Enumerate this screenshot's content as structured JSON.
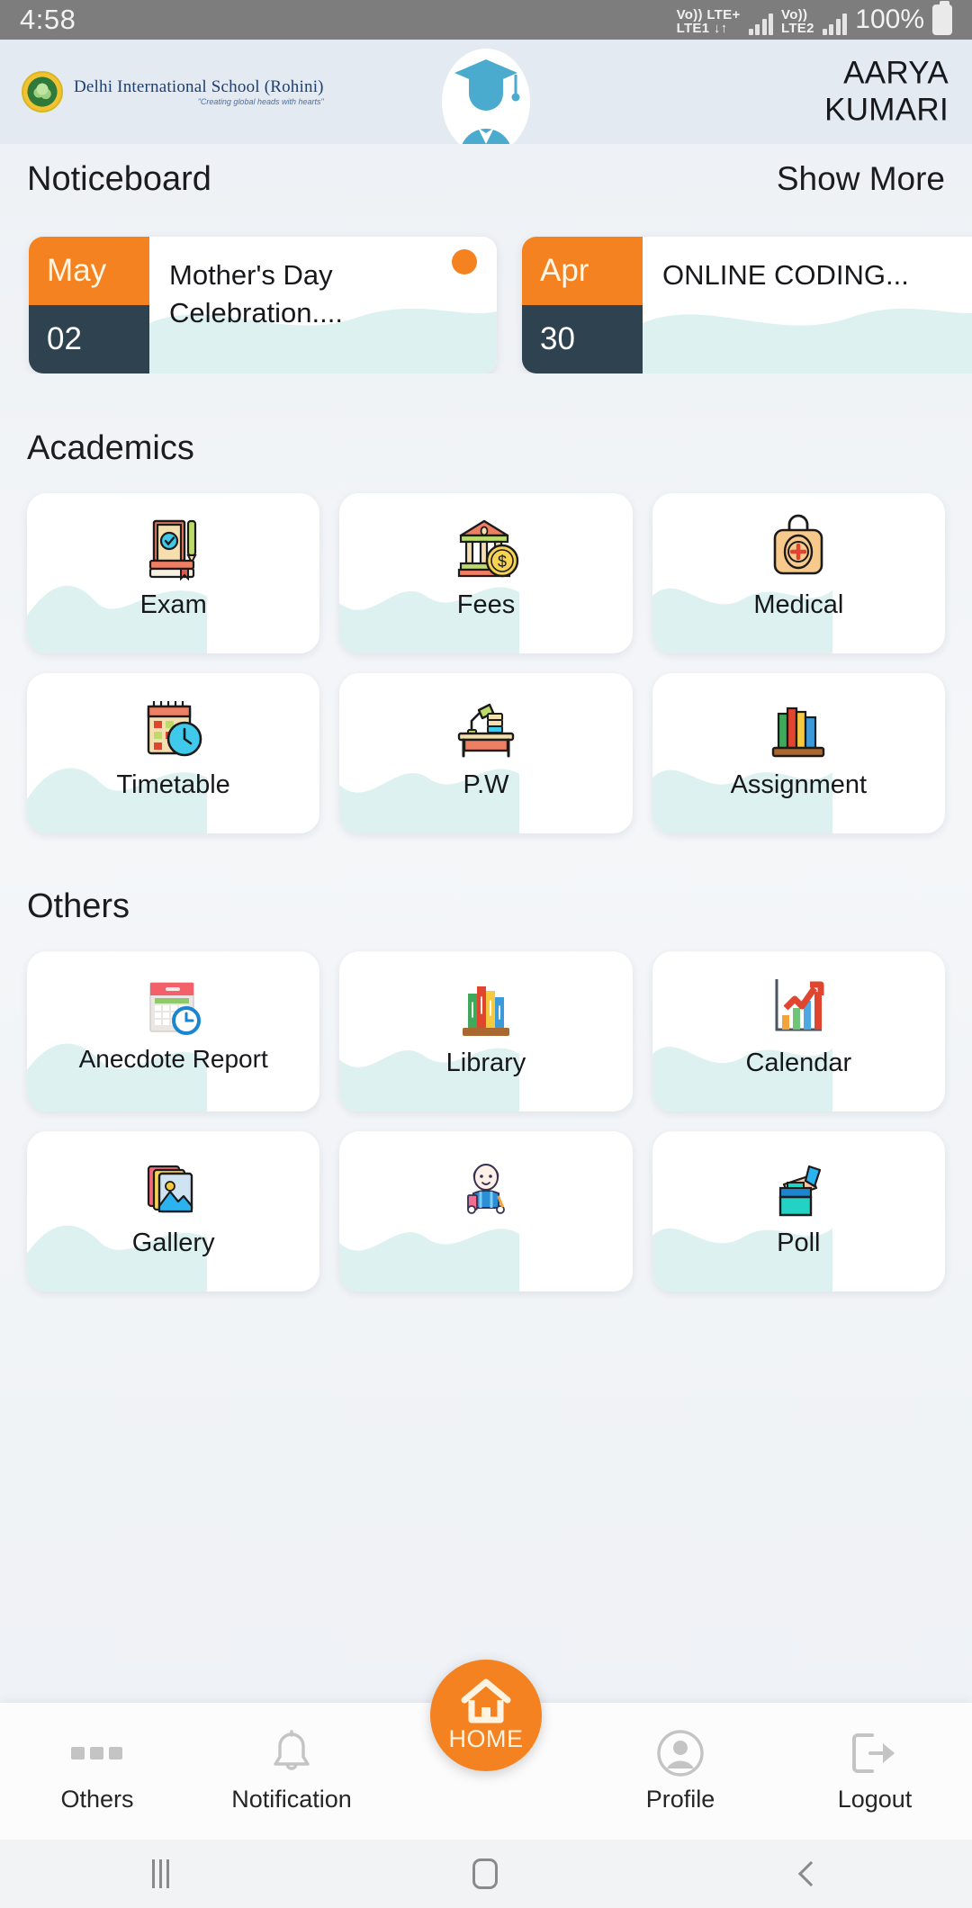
{
  "status_bar": {
    "time": "4:58",
    "sim1_line1": "Vo)) LTE+",
    "sim1_line2": "LTE1 ↓↑",
    "sim2_line1": "Vo))",
    "sim2_line2": "LTE2",
    "battery": "100%"
  },
  "header": {
    "school_name": "Delhi International School (Rohini)",
    "school_tagline": "\"Creating global heads with hearts\"",
    "student_name_line1": "AARYA",
    "student_name_line2": "KUMARI",
    "logo_icon": "school-crest-tree-icon",
    "avatar_icon": "graduate-student-avatar-icon"
  },
  "noticeboard": {
    "title": "Noticeboard",
    "show_more": "Show More",
    "items": [
      {
        "month": "May",
        "day": "02",
        "text": "Mother's Day Celebration....",
        "unread": true
      },
      {
        "month": "Apr",
        "day": "30",
        "text": "ONLINE CODING...",
        "unread": false
      }
    ]
  },
  "academics": {
    "title": "Academics",
    "tiles": [
      {
        "label": "Exam",
        "icon": "exam-papers-pen-icon"
      },
      {
        "label": "Fees",
        "icon": "bank-coin-icon"
      },
      {
        "label": "Medical",
        "icon": "first-aid-kit-icon"
      },
      {
        "label": "Timetable",
        "icon": "calendar-clock-icon"
      },
      {
        "label": "P.W",
        "icon": "study-desk-lamp-icon"
      },
      {
        "label": "Assignment",
        "icon": "books-shelf-icon"
      }
    ]
  },
  "others": {
    "title": "Others",
    "tiles": [
      {
        "label": "Anecdote Report",
        "icon": "calendar-clock-report-icon"
      },
      {
        "label": "Library",
        "icon": "library-books-icon"
      },
      {
        "label": "Calendar",
        "icon": "growth-chart-icon"
      },
      {
        "label": "Gallery",
        "icon": "photo-stack-icon"
      },
      {
        "label": "",
        "icon": "student-reading-icon"
      },
      {
        "label": "Poll",
        "icon": "ballot-box-icon"
      }
    ]
  },
  "bottom_nav": {
    "items": [
      {
        "label": "Others",
        "icon": "three-dots-icon"
      },
      {
        "label": "Notification",
        "icon": "bell-icon"
      },
      {
        "label": "Profile",
        "icon": "user-circle-icon"
      },
      {
        "label": "Logout",
        "icon": "logout-arrow-icon"
      }
    ],
    "home_label": "HOME",
    "home_icon": "house-icon"
  },
  "system_nav": {
    "recents_icon": "recents-bars-icon",
    "home_icon": "home-square-icon",
    "back_icon": "back-chevron-icon"
  },
  "colors": {
    "accent_orange": "#f58220",
    "date_dark": "#2f4250",
    "header_bg": "#e4eaf2",
    "wave_teal": "#dff2f0"
  }
}
